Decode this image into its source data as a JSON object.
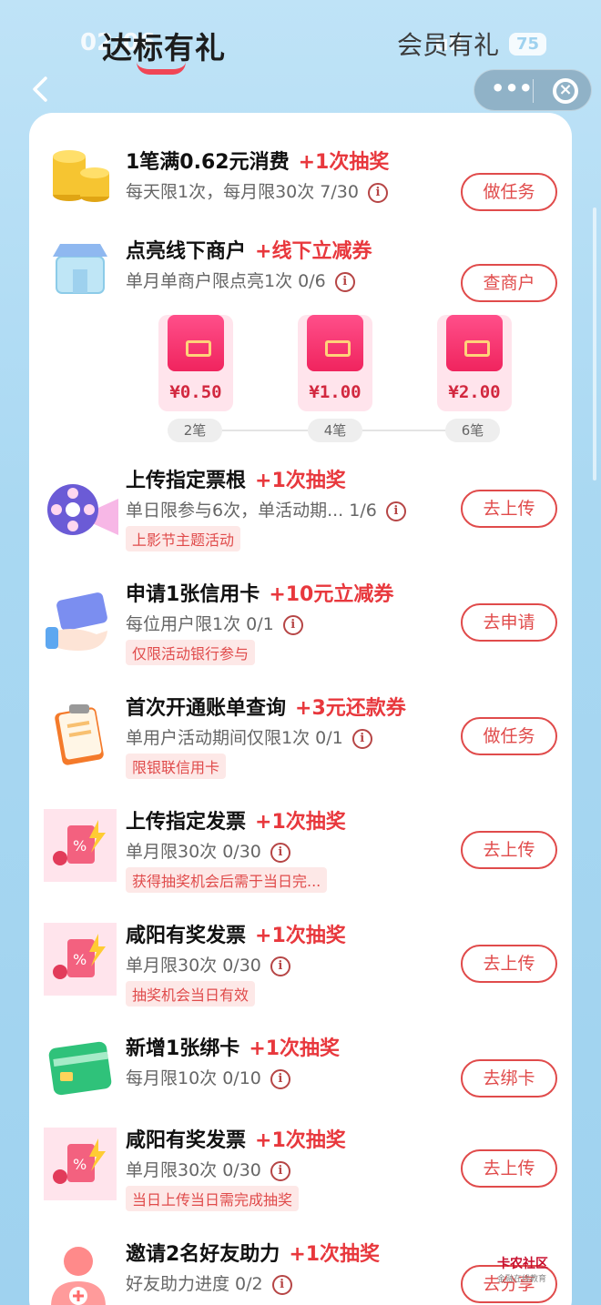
{
  "status_bar": {
    "time": "02:06",
    "signal": "ull",
    "battery": "75"
  },
  "tabs": {
    "active": "达标有礼",
    "other": "会员有礼"
  },
  "colors": {
    "accent": "#e04b4b",
    "reward": "#e8383d",
    "card_bg": "#ffffff",
    "page_bg": "#a9d8f2"
  },
  "tasks": [
    {
      "icon": "gold-coins-icon",
      "title": "1笔满0.62元消费",
      "reward": "+1次抽奖",
      "sub": "每天限1次，每月限30次 7/30",
      "tag": "",
      "button": "做任务"
    },
    {
      "icon": "storefront-icon",
      "title": "点亮线下商户",
      "reward": "+线下立减券",
      "sub": "单月单商户限点亮1次 0/6",
      "tag": "",
      "button": "查商户"
    },
    {
      "icon": "film-reel-icon",
      "title": "上传指定票根",
      "reward": "+1次抽奖",
      "sub": "单日限参与6次，单活动期...  1/6",
      "tag": "上影节主题活动",
      "button": "去上传"
    },
    {
      "icon": "credit-card-hand-icon",
      "title": "申请1张信用卡",
      "reward": "+10元立减券",
      "sub": "每位用户限1次 0/1",
      "tag": "仅限活动银行参与",
      "button": "去申请"
    },
    {
      "icon": "clipboard-icon",
      "title": "首次开通账单查询",
      "reward": "+3元还款券",
      "sub": "单用户活动期间仅限1次 0/1",
      "tag": "限银联信用卡",
      "button": "做任务"
    },
    {
      "icon": "invoice-lottery-icon",
      "title": "上传指定发票",
      "reward": "+1次抽奖",
      "sub": "单月限30次 0/30",
      "tag": "获得抽奖机会后需于当日完...",
      "button": "去上传"
    },
    {
      "icon": "invoice-lottery-icon",
      "title": "咸阳有奖发票",
      "reward": "+1次抽奖",
      "sub": "单月限30次 0/30",
      "tag": "抽奖机会当日有效",
      "button": "去上传"
    },
    {
      "icon": "green-card-icon",
      "title": "新增1张绑卡",
      "reward": "+1次抽奖",
      "sub": "每月限10次 0/10",
      "tag": "",
      "button": "去绑卡"
    },
    {
      "icon": "invoice-lottery-icon",
      "title": "咸阳有奖发票",
      "reward": "+1次抽奖",
      "sub": "单月限30次 0/30",
      "tag": "当日上传当日需完成抽奖",
      "button": "去上传"
    },
    {
      "icon": "invite-friend-icon",
      "title": "邀请2名好友助力",
      "reward": "+1次抽奖",
      "sub": "好友助力进度 0/2",
      "tag": "",
      "button": "去分享"
    }
  ],
  "packets": [
    {
      "amount": "¥0.50",
      "step": "2笔"
    },
    {
      "amount": "¥1.00",
      "step": "4笔"
    },
    {
      "amount": "¥2.00",
      "step": "6笔"
    }
  ],
  "info_glyph": "i",
  "watermark": {
    "line1": "卡农社区",
    "line2": "金融在线教育"
  }
}
